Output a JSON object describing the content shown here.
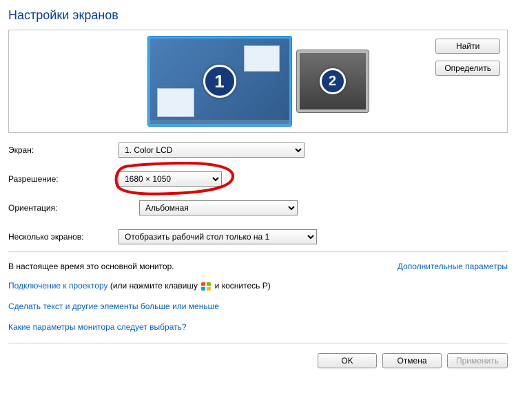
{
  "title": "Настройки экранов",
  "monitors": {
    "m1": "1",
    "m2": "2"
  },
  "buttons": {
    "find": "Найти",
    "identify": "Определить",
    "ok": "OK",
    "cancel": "Отмена",
    "apply": "Применить"
  },
  "labels": {
    "screen": "Экран:",
    "resolution": "Разрешение:",
    "orientation": "Ориентация:",
    "multiple": "Несколько экранов:"
  },
  "values": {
    "screen": "1. Color LCD",
    "resolution": "1680 × 1050",
    "orientation": "Альбомная",
    "multiple": "Отобразить рабочий стол только на 1"
  },
  "status": "В настоящее время это основной монитор.",
  "links": {
    "advanced": "Дополнительные параметры",
    "projector": "Подключение к проектору",
    "projector_suffix_a": " (или нажмите клавишу ",
    "projector_suffix_b": " и коснитесь P)",
    "textsize": "Сделать текст и другие элементы больше или меньше",
    "which": "Какие параметры монитора следует выбрать?"
  }
}
